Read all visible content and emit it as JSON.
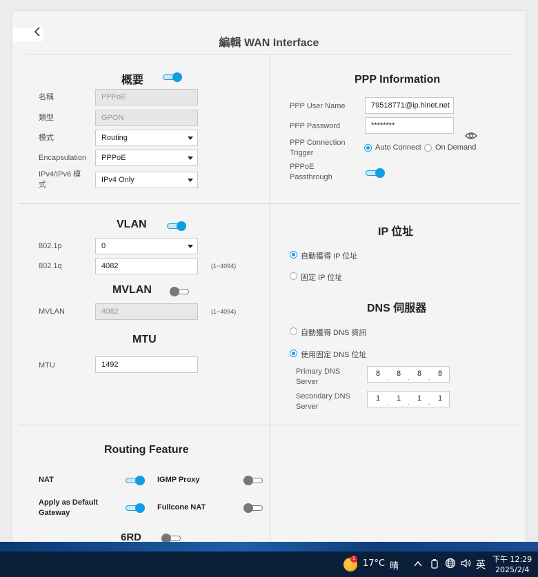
{
  "page": {
    "title": "編輯 WAN Interface"
  },
  "overview": {
    "title": "概要",
    "enabled": true,
    "fields": {
      "name_label": "名稱",
      "name_value": "PPPoE",
      "type_label": "類型",
      "type_value": "GPON",
      "mode_label": "模式",
      "mode_value": "Routing",
      "encap_label": "Encapsulation",
      "encap_value": "PPPoE",
      "ipv_label": "IPv4/IPv6 模式",
      "ipv_value": "IPv4 Only"
    }
  },
  "ppp": {
    "title": "PPP Information",
    "user_label": "PPP User Name",
    "user_value": "79518771@ip.hinet.net",
    "pass_label": "PPP Password",
    "pass_value": "********",
    "trigger_label": "PPP Connection Trigger",
    "auto_label": "Auto Connect",
    "demand_label": "On Demand",
    "passthrough_label": "PPPoE Passthrough"
  },
  "vlan": {
    "title": "VLAN",
    "p_label": "802.1p",
    "p_value": "0",
    "q_label": "802.1q",
    "q_value": "4082",
    "q_hint": "(1~4094)"
  },
  "mvlan": {
    "title": "MVLAN",
    "label": "MVLAN",
    "value": "4082",
    "hint": "(1~4094)"
  },
  "mtu": {
    "title": "MTU",
    "label": "MTU",
    "value": "1492"
  },
  "ip": {
    "title": "IP 位址",
    "auto_label": "自動獲得 IP 位址",
    "static_label": "固定 IP 位址"
  },
  "dns": {
    "title": "DNS 伺服器",
    "auto_label": "自動獲得 DNS 資訊",
    "static_label": "使用固定 DNS 位址",
    "primary_label": "Primary DNS Server",
    "primary": [
      "8",
      "8",
      "8",
      "8"
    ],
    "secondary_label": "Secondary DNS Server",
    "secondary": [
      "1",
      "1",
      "1",
      "1"
    ]
  },
  "routing": {
    "title": "Routing Feature",
    "nat_label": "NAT",
    "igmp_label": "IGMP Proxy",
    "default_gw_label": "Apply as Default Gateway",
    "fullcone_label": "Fullcone NAT",
    "sixrd_label": "6RD"
  },
  "taskbar": {
    "badge": "1",
    "temp": "17°C",
    "weather": "晴",
    "ime": "英",
    "time": "下午 12:29",
    "date": "2025/2/4"
  },
  "colors": {
    "accent": "#0e9ee6",
    "taskbar": "#0b1f3a"
  }
}
